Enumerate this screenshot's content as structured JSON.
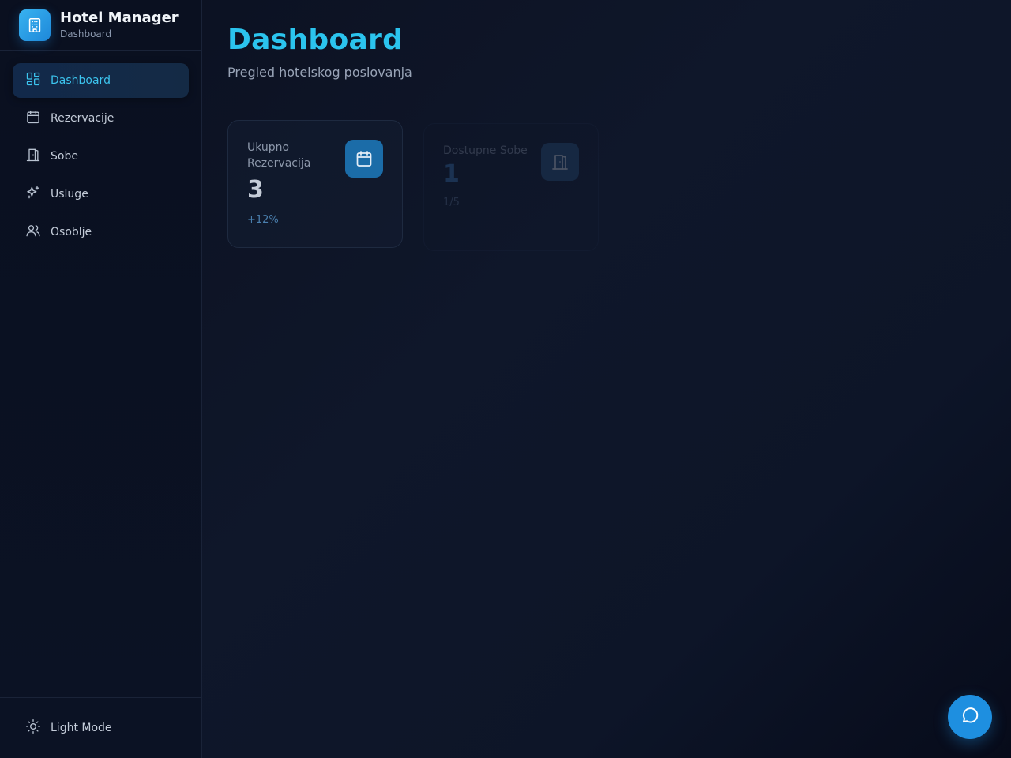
{
  "app": {
    "title": "Hotel Manager",
    "subtitle": "Dashboard",
    "logo_icon": "building-icon",
    "accent": "#2bc4ee"
  },
  "sidebar": {
    "items": [
      {
        "label": "Dashboard",
        "icon": "layout-grid-icon",
        "active": true
      },
      {
        "label": "Rezervacije",
        "icon": "calendar-icon",
        "active": false
      },
      {
        "label": "Sobe",
        "icon": "door-icon",
        "active": false
      },
      {
        "label": "Usluge",
        "icon": "sparkles-icon",
        "active": false
      },
      {
        "label": "Osoblje",
        "icon": "users-icon",
        "active": false
      }
    ],
    "footer": {
      "theme_toggle_label": "Light Mode",
      "icon": "sun-icon"
    }
  },
  "main": {
    "title": "Dashboard",
    "subtitle": "Pregled hotelskog poslovanja",
    "cards": [
      {
        "label": "Ukupno Rezervacija",
        "value": "3",
        "trend": "+12%",
        "icon": "calendar-icon"
      },
      {
        "label": "Dostupne Sobe",
        "value": "1",
        "trend": "1/5",
        "icon": "door-icon"
      }
    ]
  },
  "chat_button": {
    "icon": "chat-bubble-icon"
  }
}
